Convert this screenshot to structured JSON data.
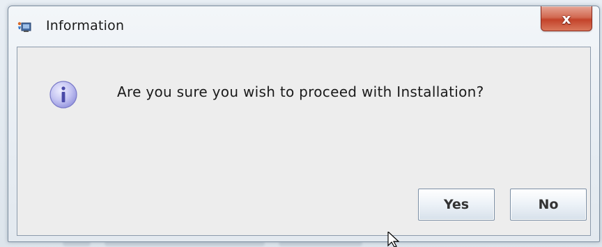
{
  "dialog": {
    "title": "Information",
    "close_label": "x",
    "message": "Are you sure you wish to proceed with Installation?",
    "icon": "info-icon",
    "buttons": {
      "yes_label": "Yes",
      "no_label": "No"
    }
  },
  "colors": {
    "close_button": "#c3432a",
    "info_icon_fill": "#b8b8f0",
    "content_background": "#ededed"
  }
}
